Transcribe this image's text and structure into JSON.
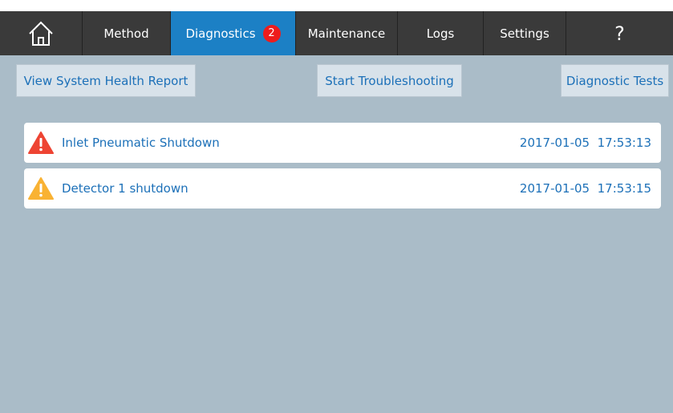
{
  "nav": {
    "home_icon": "home-icon",
    "method": "Method",
    "diagnostics": "Diagnostics",
    "diagnostics_badge": "2",
    "maintenance": "Maintenance",
    "logs": "Logs",
    "settings": "Settings",
    "help": "?"
  },
  "actions": {
    "health_report": "View System Health Report",
    "troubleshooting": "Start Troubleshooting",
    "diagnostic_tests": "Diagnostic Tests"
  },
  "alerts": [
    {
      "label": "Inlet Pneumatic Shutdown",
      "date": "2017-01-05",
      "time": "17:53:13",
      "datetime": "2017-01-05  17:53:13",
      "severity": "error",
      "icon": "error-warning-icon",
      "color": "#ee4433"
    },
    {
      "label": "Detector 1 shutdown",
      "date": "2017-01-05",
      "time": "17:53:15",
      "datetime": "2017-01-05  17:53:15",
      "severity": "warning",
      "icon": "warning-icon",
      "color": "#f9b233"
    }
  ],
  "colors": {
    "navbar": "#3a3a3a",
    "active_tab": "#1c80c5",
    "background": "#aabcc8",
    "link_text": "#1c70b8",
    "badge": "#ee1c1c"
  }
}
